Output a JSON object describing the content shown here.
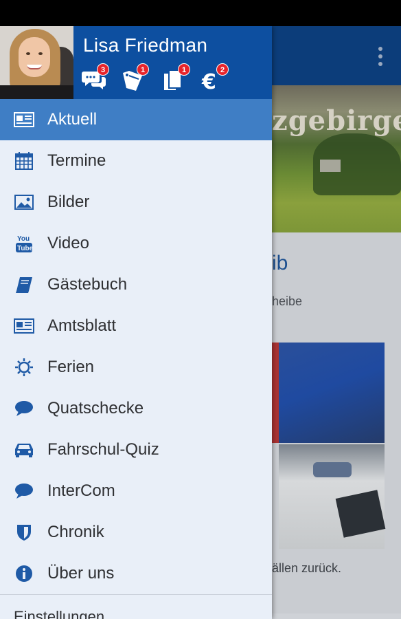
{
  "profile": {
    "name": "Lisa Friedman",
    "badges": [
      {
        "icon": "chat-icon",
        "count": "3"
      },
      {
        "icon": "tag-icon",
        "count": "1"
      },
      {
        "icon": "copy-icon",
        "count": "1"
      },
      {
        "icon": "euro-icon",
        "count": "2"
      }
    ]
  },
  "menu": {
    "items": [
      {
        "label": "Aktuell",
        "icon": "newspaper-icon",
        "active": true
      },
      {
        "label": "Termine",
        "icon": "calendar-icon"
      },
      {
        "label": "Bilder",
        "icon": "image-icon"
      },
      {
        "label": "Video",
        "icon": "youtube-icon"
      },
      {
        "label": "Gästebuch",
        "icon": "book-icon"
      },
      {
        "label": "Amtsblatt",
        "icon": "newspaper-icon"
      },
      {
        "label": "Ferien",
        "icon": "sun-icon"
      },
      {
        "label": "Quatschecke",
        "icon": "speech-bubble-icon"
      },
      {
        "label": "Fahrschul-Quiz",
        "icon": "car-icon"
      },
      {
        "label": "InterCom",
        "icon": "speech-bubble-icon"
      },
      {
        "label": "Chronik",
        "icon": "shield-icon"
      },
      {
        "label": "Über uns",
        "icon": "info-icon"
      }
    ],
    "settings_label": "Einstellungen"
  },
  "background": {
    "hero_text": "zgebirge",
    "headline_fragment": "ib",
    "subtitle_fragment": "heibe",
    "caption_fragment": "ällen zurück."
  },
  "colors": {
    "brand_blue": "#0d4fa0",
    "active_item": "#3f7ec5",
    "drawer_bg": "#e9eff8",
    "badge_red": "#e8242b",
    "icon_blue": "#1f5aa6"
  }
}
